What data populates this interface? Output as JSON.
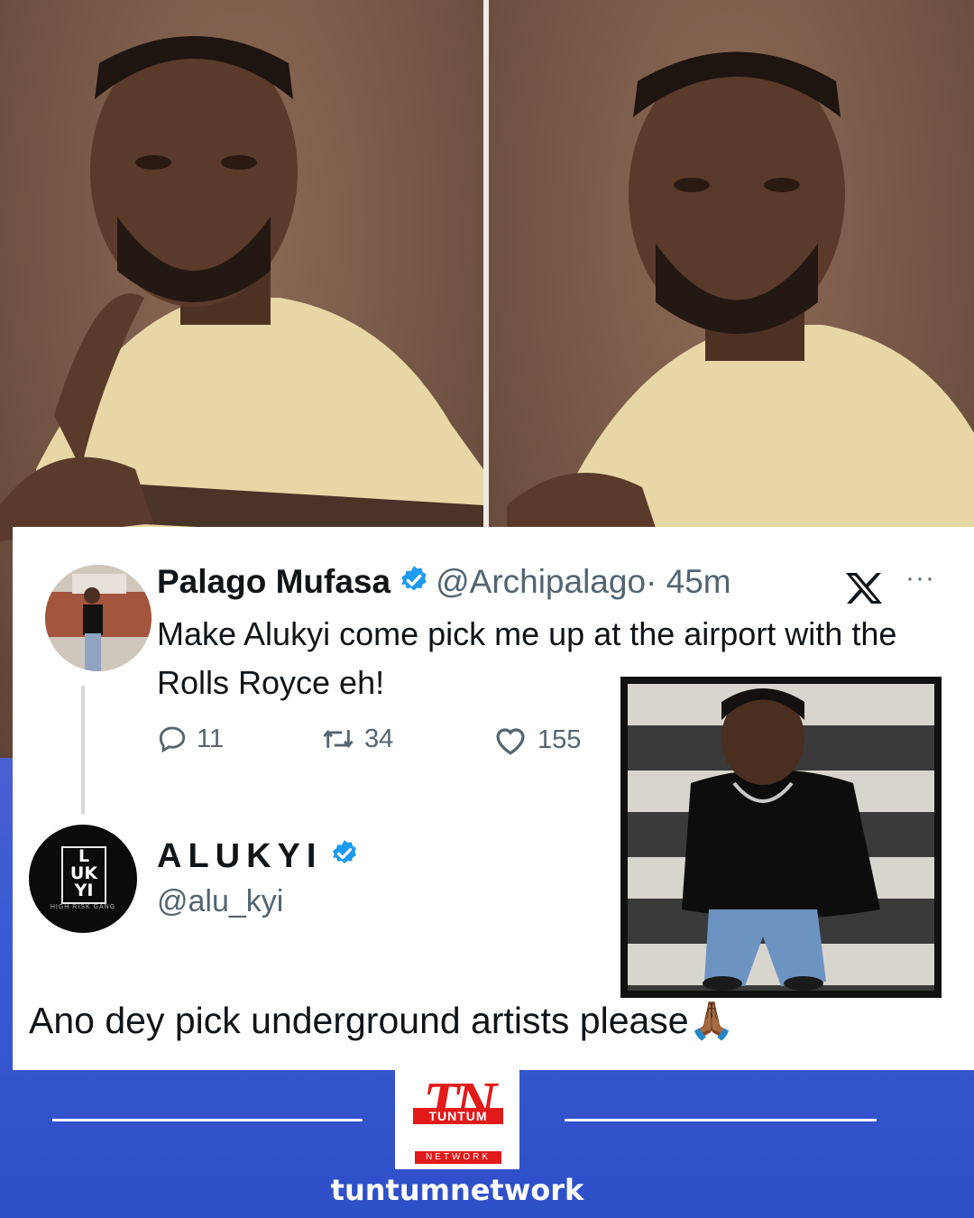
{
  "tweet": {
    "author_name": "Palago Mufasa",
    "author_handle": "@Archipalago",
    "time": "· 45m",
    "text": "Make Alukyi  come pick me up at the airport with the Rolls Royce eh!",
    "replies": "11",
    "retweets": "34",
    "likes": "155",
    "more_label": "···"
  },
  "reply": {
    "author_name": "ALUKYI",
    "author_handle": "@alu_kyi",
    "text": "Ano dey pick underground artists please🙏🏾",
    "avatar_lines": [
      "L",
      "UK",
      "YI"
    ],
    "avatar_sub": "HIGH RISK GANG"
  },
  "footer": {
    "logo_mark": "TN",
    "logo_tuntum": "TUNTUM",
    "logo_network": "NETWORK",
    "brand": "tuntumnetwork"
  },
  "colors": {
    "verified": "#1d9bf0",
    "brand_red": "#e21a1a",
    "text_dark": "#0f1419",
    "text_muted": "#536471"
  }
}
